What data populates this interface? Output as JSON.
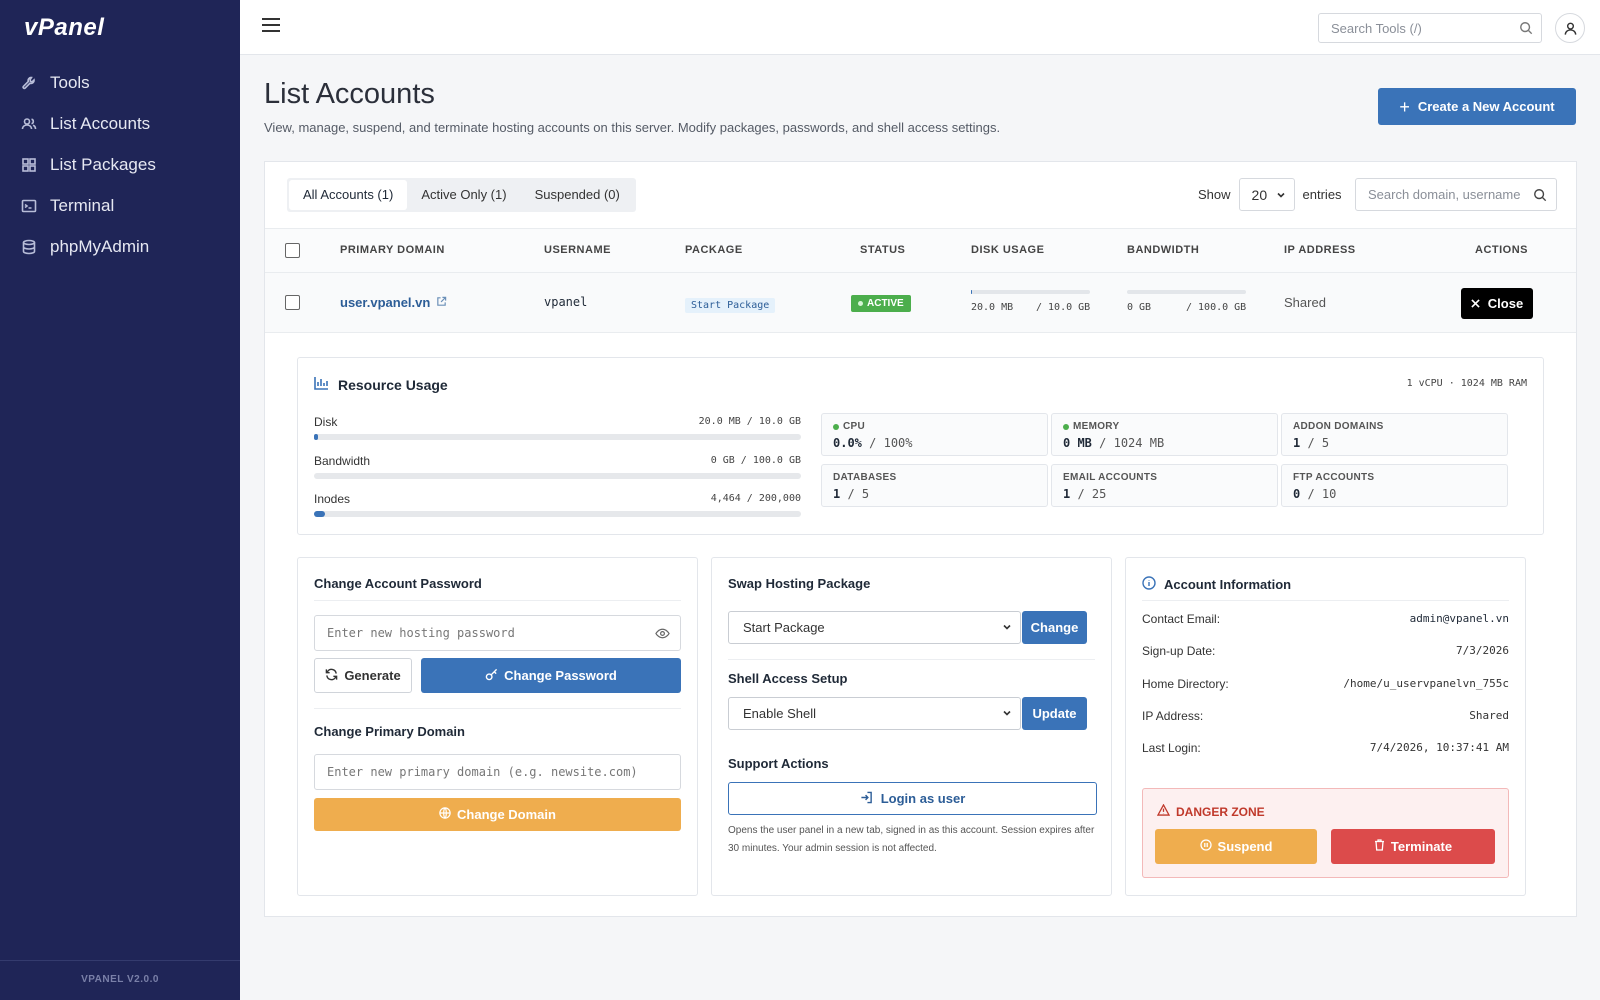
{
  "app": {
    "logo": "vPanel",
    "version": "VPANEL V2.0.0"
  },
  "sidebar": {
    "items": [
      {
        "label": "Tools",
        "icon": "wrench-icon"
      },
      {
        "label": "List Accounts",
        "icon": "users-icon"
      },
      {
        "label": "List Packages",
        "icon": "grid-icon"
      },
      {
        "label": "Terminal",
        "icon": "terminal-icon"
      },
      {
        "label": "phpMyAdmin",
        "icon": "database-icon"
      }
    ]
  },
  "topbar": {
    "search_placeholder": "Search Tools (/)"
  },
  "header": {
    "title": "List Accounts",
    "description": "View, manage, suspend, and terminate hosting accounts on this server. Modify packages, passwords, and shell access settings.",
    "create_button": "Create a New Account"
  },
  "filters": {
    "tabs": [
      "All Accounts (1)",
      "Active Only (1)",
      "Suspended (0)"
    ],
    "active_tab": 0,
    "show_label": "Show",
    "entries_value": "20",
    "entries_label": "entries",
    "search_placeholder": "Search domain, username"
  },
  "table": {
    "headers": [
      "PRIMARY DOMAIN",
      "USERNAME",
      "PACKAGE",
      "STATUS",
      "DISK USAGE",
      "BANDWIDTH",
      "IP ADDRESS",
      "ACTIONS"
    ],
    "rows": [
      {
        "domain": "user.vpanel.vn",
        "username": "vpanel",
        "package": "Start Package",
        "status": "ACTIVE",
        "disk_used": "20.0 MB",
        "disk_total": "/ 10.0 GB",
        "disk_pct": 0.2,
        "bw_used": "0 GB",
        "bw_total": "/ 100.0 GB",
        "bw_pct": 0,
        "ip": "Shared",
        "action": "Close"
      }
    ]
  },
  "resources": {
    "title": "Resource Usage",
    "spec": "1 vCPU · 1024 MB RAM",
    "bars": [
      {
        "label": "Disk",
        "value": "20.0 MB / 10.0 GB",
        "pct": 0.2
      },
      {
        "label": "Bandwidth",
        "value": "0 GB / 100.0 GB",
        "pct": 0
      },
      {
        "label": "Inodes",
        "value": "4,464 / 200,000",
        "pct": 2.2
      }
    ],
    "stats": [
      {
        "label": "CPU",
        "used": "0.0%",
        "total": "/ 100%",
        "dot": true
      },
      {
        "label": "MEMORY",
        "used": "0 MB",
        "total": "/ 1024 MB",
        "dot": true
      },
      {
        "label": "ADDON DOMAINS",
        "used": "1",
        "total": "/ 5",
        "dot": false
      },
      {
        "label": "DATABASES",
        "used": "1",
        "total": "/ 5",
        "dot": false
      },
      {
        "label": "EMAIL ACCOUNTS",
        "used": "1",
        "total": "/ 25",
        "dot": false
      },
      {
        "label": "FTP ACCOUNTS",
        "used": "0",
        "total": "/ 10",
        "dot": false
      }
    ]
  },
  "password_panel": {
    "title": "Change Account Password",
    "placeholder": "Enter new hosting password",
    "generate_label": "Generate",
    "change_label": "Change Password",
    "domain_title": "Change Primary Domain",
    "domain_placeholder": "Enter new primary domain (e.g. newsite.com)",
    "domain_button": "Change Domain"
  },
  "package_panel": {
    "title": "Swap Hosting Package",
    "package_value": "Start Package",
    "change_label": "Change",
    "shell_title": "Shell Access Setup",
    "shell_value": "Enable Shell",
    "update_label": "Update",
    "support_title": "Support Actions",
    "login_label": "Login as user",
    "note": "Opens the user panel in a new tab, signed in as this account. Session expires after 30 minutes. Your admin session is not affected."
  },
  "info_panel": {
    "title": "Account Information",
    "rows": [
      {
        "label": "Contact Email:",
        "value": "admin@vpanel.vn"
      },
      {
        "label": "Sign-up Date:",
        "value": "7/3/2026"
      },
      {
        "label": "Home Directory:",
        "value": "/home/u_uservpanelvn_755c"
      },
      {
        "label": "IP Address:",
        "value": "Shared"
      },
      {
        "label": "Last Login:",
        "value": "7/4/2026, 10:37:41 AM"
      }
    ],
    "danger_title": "DANGER ZONE",
    "suspend_label": "Suspend",
    "terminate_label": "Terminate"
  }
}
